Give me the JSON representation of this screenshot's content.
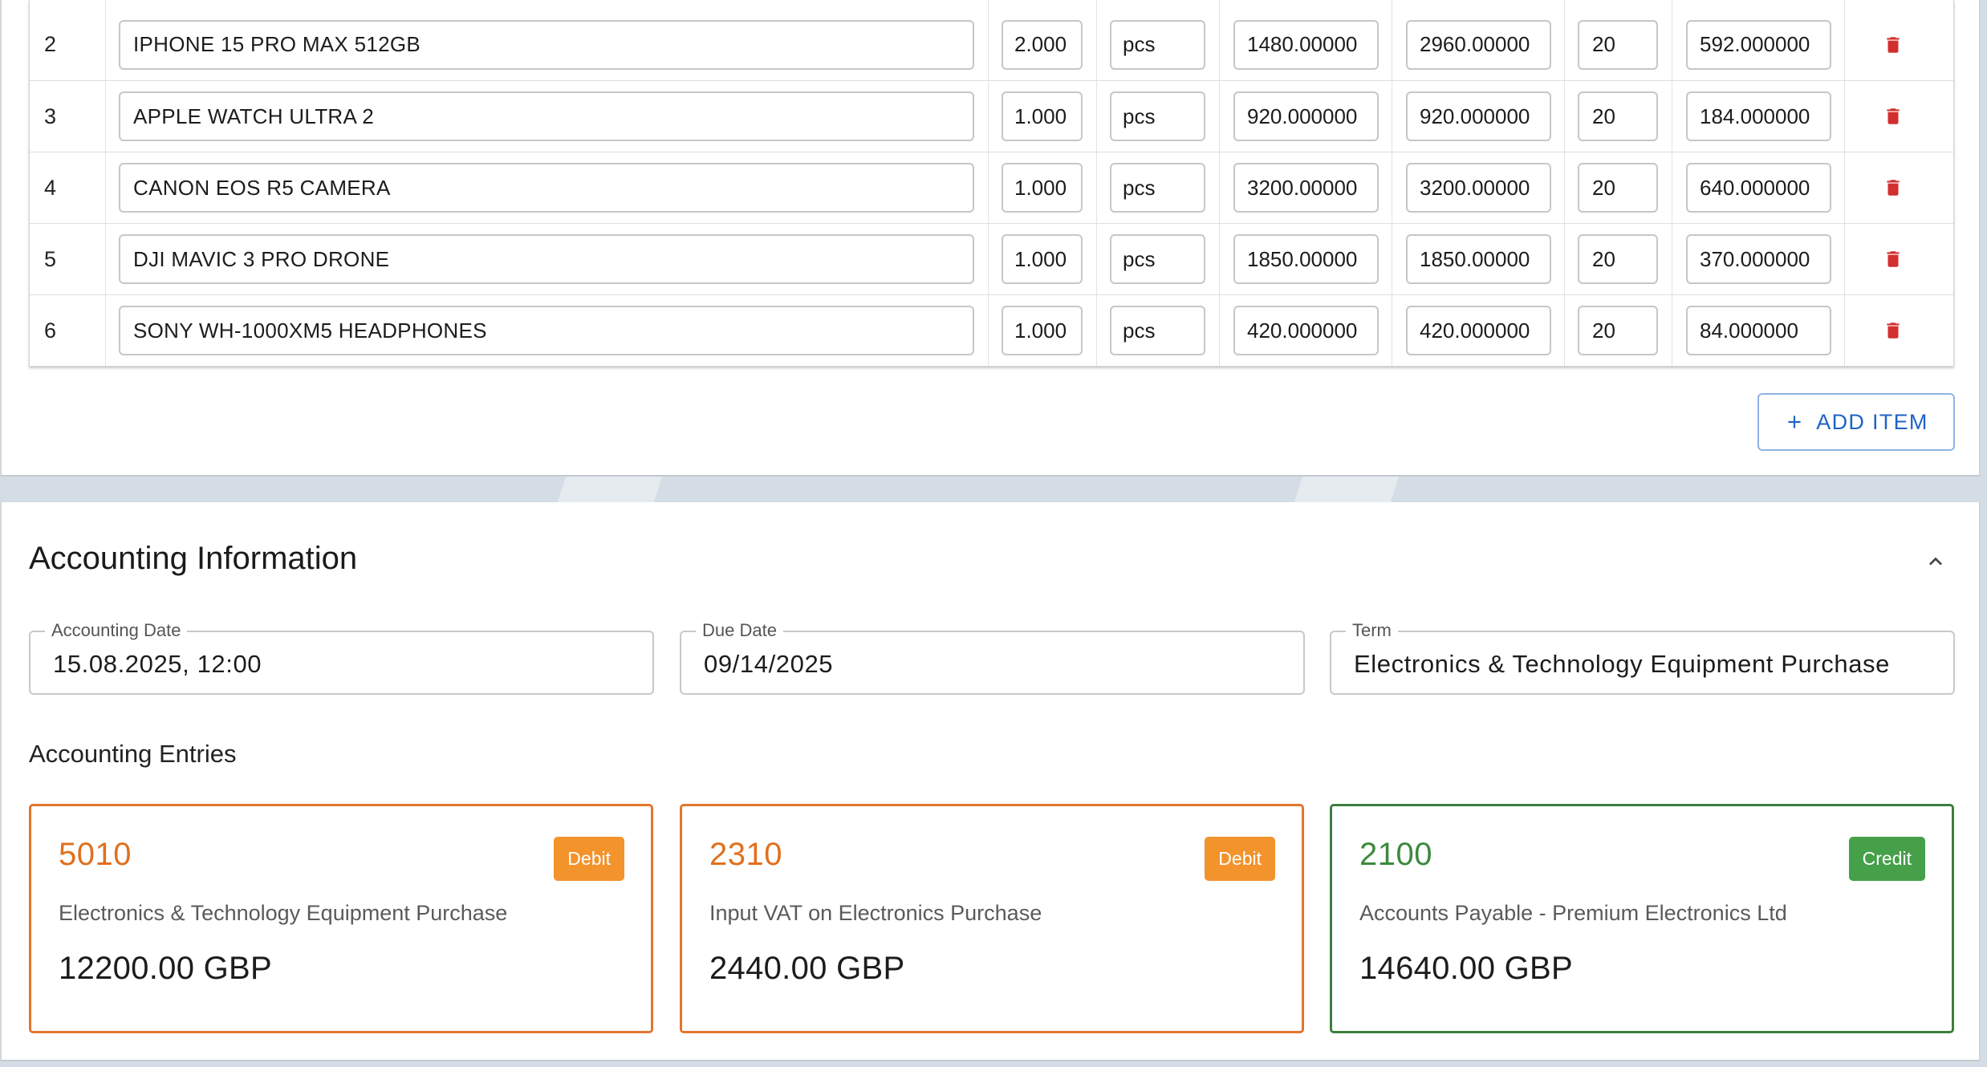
{
  "items": [
    {
      "no": "2",
      "description": "IPHONE 15 PRO MAX 512GB",
      "qty": "2.000",
      "unit": "pcs",
      "price": "1480.00000",
      "amount": "2960.00000",
      "vat_rate": "20",
      "vat_amount": "592.000000"
    },
    {
      "no": "3",
      "description": "APPLE WATCH ULTRA 2",
      "qty": "1.000",
      "unit": "pcs",
      "price": "920.000000",
      "amount": "920.000000",
      "vat_rate": "20",
      "vat_amount": "184.000000"
    },
    {
      "no": "4",
      "description": "CANON EOS R5 CAMERA",
      "qty": "1.000",
      "unit": "pcs",
      "price": "3200.00000",
      "amount": "3200.00000",
      "vat_rate": "20",
      "vat_amount": "640.000000"
    },
    {
      "no": "5",
      "description": "DJI MAVIC 3 PRO DRONE",
      "qty": "1.000",
      "unit": "pcs",
      "price": "1850.00000",
      "amount": "1850.00000",
      "vat_rate": "20",
      "vat_amount": "370.000000"
    },
    {
      "no": "6",
      "description": "SONY WH-1000XM5 HEADPHONES",
      "qty": "1.000",
      "unit": "pcs",
      "price": "420.000000",
      "amount": "420.000000",
      "vat_rate": "20",
      "vat_amount": "84.000000"
    }
  ],
  "add_item_label": "ADD ITEM",
  "accounting": {
    "title": "Accounting Information",
    "accounting_date": {
      "label": "Accounting Date",
      "value": "15.08.2025, 12:00"
    },
    "due_date": {
      "label": "Due Date",
      "value": "09/14/2025"
    },
    "term": {
      "label": "Term",
      "value": "Electronics & Technology Equipment Purchase"
    },
    "entries_title": "Accounting Entries",
    "entries": [
      {
        "account": "5010",
        "type": "Debit",
        "description": "Electronics & Technology Equipment Purchase",
        "amount": "12200.00 GBP"
      },
      {
        "account": "2310",
        "type": "Debit",
        "description": "Input VAT on Electronics Purchase",
        "amount": "2440.00 GBP"
      },
      {
        "account": "2100",
        "type": "Credit",
        "description": "Accounts Payable - Premium Electronics Ltd",
        "amount": "14640.00 GBP"
      }
    ]
  },
  "colors": {
    "debit": "#f2932b",
    "credit": "#46a04a",
    "delete_icon": "#d32f2f",
    "primary": "#1f63c6"
  },
  "icons": {
    "delete": "trash-icon",
    "add": "plus-icon",
    "collapse": "chevron-up-icon"
  }
}
